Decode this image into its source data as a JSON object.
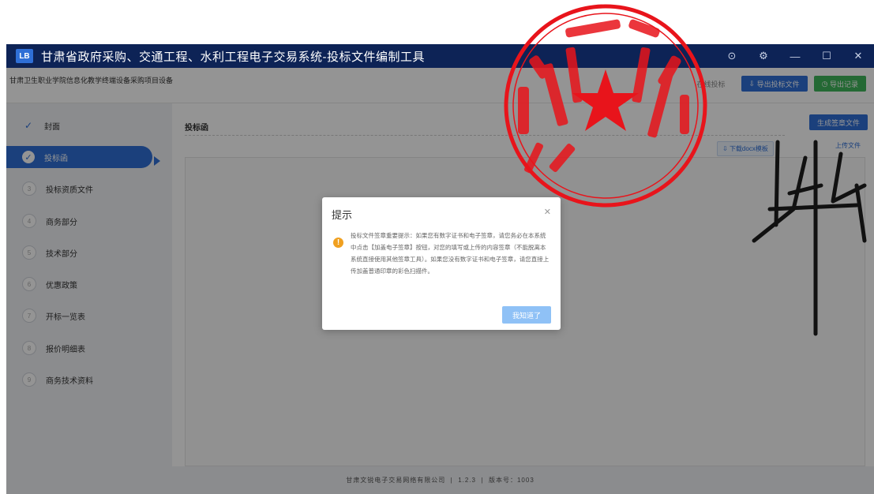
{
  "window": {
    "title": "甘肃省政府采购、交通工程、水利工程电子交易系统-投标文件编制工具",
    "logo_text": "LB"
  },
  "header": {
    "project_name": "甘肃卫生职业学院信息化教学终端设备采购项目设备",
    "link_text": "在线投标",
    "export_button": "导出投标文件",
    "record_button": "导出记录"
  },
  "sidebar": {
    "items": [
      {
        "label": "封面",
        "marker": "✓"
      },
      {
        "label": "投标函",
        "marker": "✓"
      },
      {
        "label": "投标资质文件",
        "marker": "3"
      },
      {
        "label": "商务部分",
        "marker": "4"
      },
      {
        "label": "技术部分",
        "marker": "5"
      },
      {
        "label": "优惠政策",
        "marker": "6"
      },
      {
        "label": "开标一览表",
        "marker": "7"
      },
      {
        "label": "报价明细表",
        "marker": "8"
      },
      {
        "label": "商务技术资料",
        "marker": "9"
      }
    ]
  },
  "main": {
    "section_title": "投标函",
    "generate_button": "生成签章文件",
    "download_link": "下载docx模板",
    "upload_link": "上传文件"
  },
  "dialog": {
    "title": "提示",
    "message": "投标文件签章重要提示：如果您有数字证书和电子签章，请您务必在本系统中点击【加盖电子签章】按钮，对您的填写或上传的内容签章（不能脱离本系统直接使用其他签章工具）。如果您没有数字证书和电子签章，请您直接上传加盖普通印章的彩色扫描件。",
    "confirm_button": "我知道了"
  },
  "footer": {
    "company": "甘肃文锐电子交易网络有限公司",
    "version": "1.2.3",
    "build": "版本号：1003"
  },
  "colors": {
    "titlebar": "#0d2356",
    "primary": "#2f6fd6",
    "success": "#3fb55a",
    "warning": "#f0a020",
    "seal_red": "#e8141b"
  }
}
